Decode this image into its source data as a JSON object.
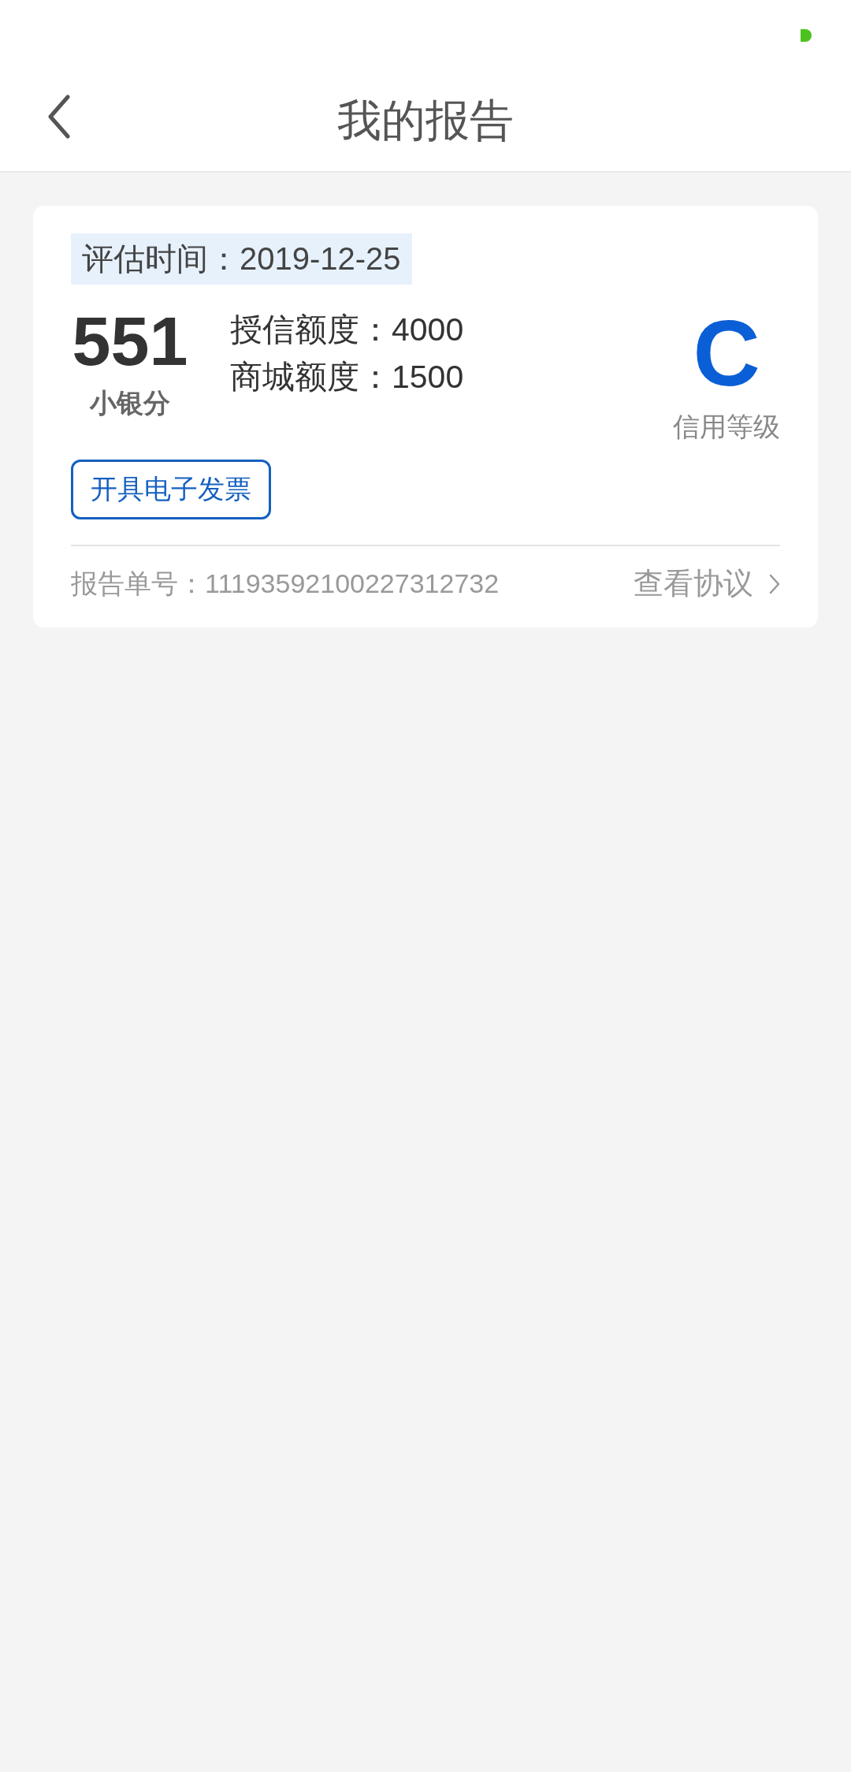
{
  "header": {
    "title": "我的报告"
  },
  "report": {
    "eval_time": "评估时间：2019-12-25",
    "score": "551",
    "score_label": "小银分",
    "limits": [
      "授信额度：4000",
      "商城额度：1500"
    ],
    "grade": "C",
    "grade_label": "信用等级",
    "invoice_button": "开具电子发票",
    "report_no": "报告单号：11193592100227312732",
    "agreement_link": "查看协议"
  }
}
